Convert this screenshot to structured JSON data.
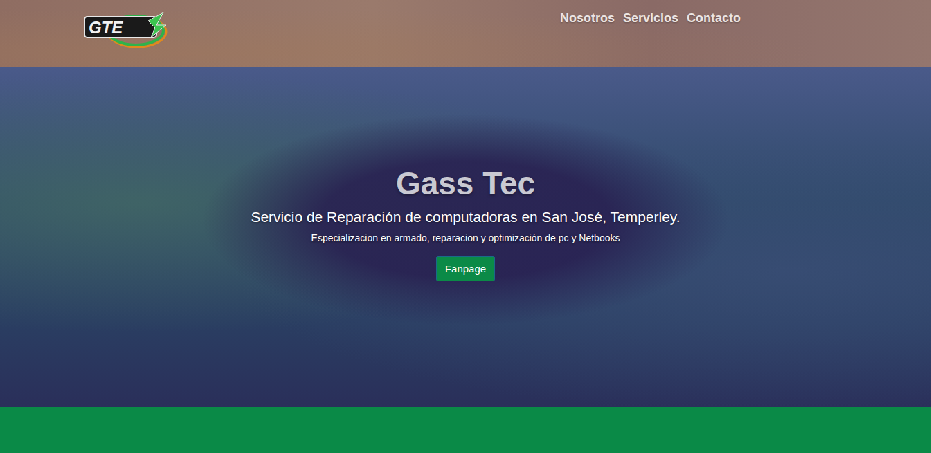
{
  "header": {
    "logo": {
      "text": "GTE"
    },
    "nav": [
      {
        "label": "Nosotros"
      },
      {
        "label": "Servicios"
      },
      {
        "label": "Contacto"
      }
    ]
  },
  "hero": {
    "title": "Gass Tec",
    "subtitle": "Servicio de Reparación de computadoras en San José, Temperley.",
    "description": "Especializacion en armado, reparacion y optimización de pc y Netbooks",
    "button": "Fanpage"
  }
}
